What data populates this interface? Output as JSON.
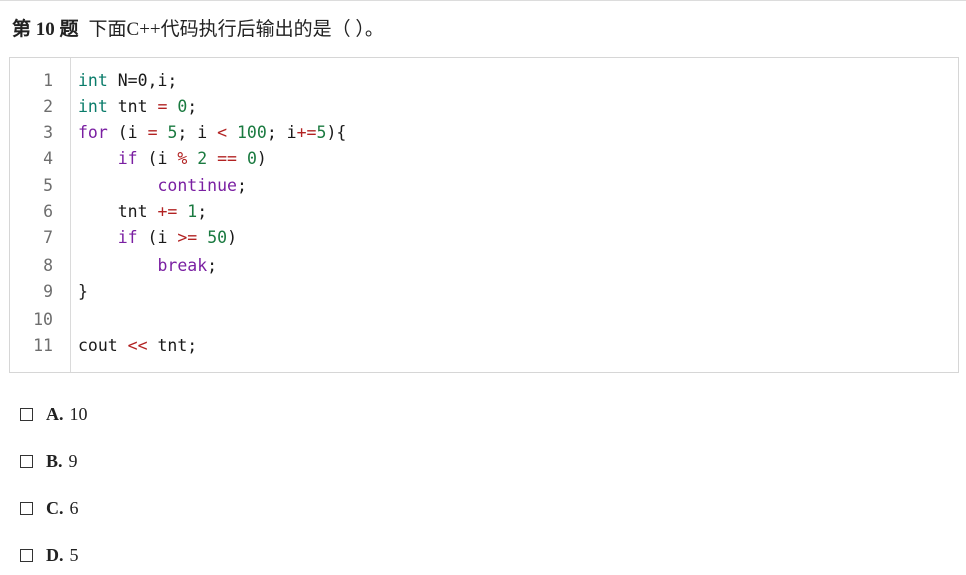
{
  "question": {
    "number_label": "第 10 题",
    "text": "下面C++代码执行后输出的是（  ）。"
  },
  "code": {
    "lines": [
      {
        "n": "1",
        "tokens": [
          [
            "kw-type",
            "int"
          ],
          [
            "plain",
            " N=0,i;"
          ]
        ]
      },
      {
        "n": "2",
        "tokens": [
          [
            "kw-type",
            "int"
          ],
          [
            "plain",
            " tnt "
          ],
          [
            "op",
            "="
          ],
          [
            "plain",
            " "
          ],
          [
            "num",
            "0"
          ],
          [
            "plain",
            ";"
          ]
        ]
      },
      {
        "n": "3",
        "tokens": [
          [
            "kw-flow",
            "for"
          ],
          [
            "plain",
            " (i "
          ],
          [
            "op",
            "="
          ],
          [
            "plain",
            " "
          ],
          [
            "num",
            "5"
          ],
          [
            "plain",
            "; i "
          ],
          [
            "op",
            "<"
          ],
          [
            "plain",
            " "
          ],
          [
            "num",
            "100"
          ],
          [
            "plain",
            "; i"
          ],
          [
            "op",
            "+="
          ],
          [
            "num",
            "5"
          ],
          [
            "plain",
            "){"
          ]
        ]
      },
      {
        "n": "4",
        "tokens": [
          [
            "plain",
            "    "
          ],
          [
            "kw-flow",
            "if"
          ],
          [
            "plain",
            " (i "
          ],
          [
            "op",
            "%"
          ],
          [
            "plain",
            " "
          ],
          [
            "num",
            "2"
          ],
          [
            "plain",
            " "
          ],
          [
            "op",
            "=="
          ],
          [
            "plain",
            " "
          ],
          [
            "num",
            "0"
          ],
          [
            "plain",
            ")"
          ]
        ]
      },
      {
        "n": "5",
        "tokens": [
          [
            "plain",
            "        "
          ],
          [
            "kw-flow",
            "continue"
          ],
          [
            "plain",
            ";"
          ]
        ]
      },
      {
        "n": "6",
        "tokens": [
          [
            "plain",
            "    tnt "
          ],
          [
            "op",
            "+="
          ],
          [
            "plain",
            " "
          ],
          [
            "num",
            "1"
          ],
          [
            "plain",
            ";"
          ]
        ]
      },
      {
        "n": "7",
        "tokens": [
          [
            "plain",
            "    "
          ],
          [
            "kw-flow",
            "if"
          ],
          [
            "plain",
            " (i "
          ],
          [
            "op",
            ">="
          ],
          [
            "plain",
            " "
          ],
          [
            "num",
            "50"
          ],
          [
            "plain",
            ")"
          ]
        ]
      },
      {
        "n": "8",
        "tokens": [
          [
            "plain",
            "        "
          ],
          [
            "kw-flow",
            "break"
          ],
          [
            "plain",
            ";"
          ]
        ]
      },
      {
        "n": "9",
        "tokens": [
          [
            "plain",
            "}"
          ]
        ]
      },
      {
        "n": "10",
        "tokens": []
      },
      {
        "n": "11",
        "tokens": [
          [
            "plain",
            "cout "
          ],
          [
            "op",
            "<<"
          ],
          [
            "plain",
            " tnt;"
          ]
        ]
      }
    ]
  },
  "options": [
    {
      "letter": "A.",
      "value": "10"
    },
    {
      "letter": "B.",
      "value": "9"
    },
    {
      "letter": "C.",
      "value": "6"
    },
    {
      "letter": "D.",
      "value": "5"
    }
  ]
}
